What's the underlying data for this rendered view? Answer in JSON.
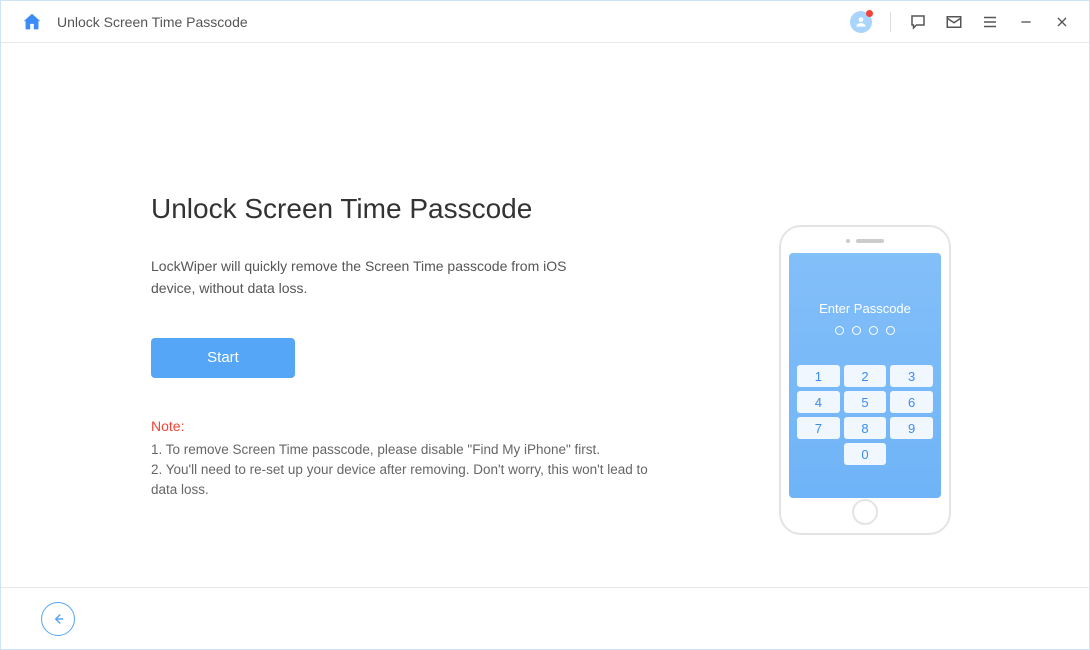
{
  "titlebar": {
    "title": "Unlock Screen Time Passcode"
  },
  "main": {
    "heading": "Unlock Screen Time Passcode",
    "description": "LockWiper will quickly remove the Screen Time passcode from iOS device, without data loss.",
    "start_label": "Start",
    "note_label": "Note:",
    "note_1": "1. To remove Screen Time passcode, please disable \"Find My iPhone\" first.",
    "note_2": "2. You'll need to re-set up your device after removing. Don't worry, this won't lead to data loss."
  },
  "phone": {
    "enter_passcode": "Enter Passcode",
    "keys": [
      "1",
      "2",
      "3",
      "4",
      "5",
      "6",
      "7",
      "8",
      "9",
      "0"
    ]
  }
}
